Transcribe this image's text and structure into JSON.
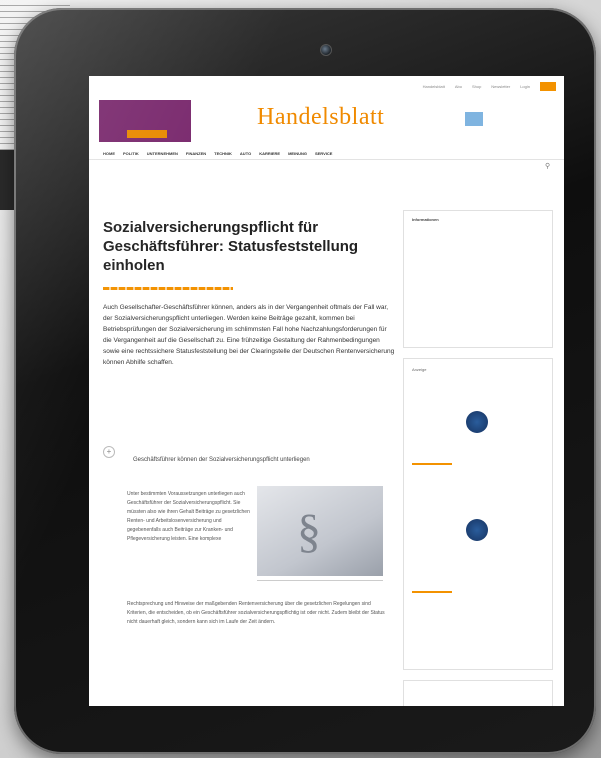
{
  "topbar": {
    "items": [
      "Handelsblatt",
      "Abo",
      "Shop",
      "Newsletter",
      "Login"
    ]
  },
  "masthead": {
    "logo": "Handelsblatt",
    "ad_line1": "",
    "ad_line2": "",
    "ad_button": "",
    "promo_text": ""
  },
  "nav": {
    "items": [
      "HOME",
      "POLITIK",
      "UNTERNEHMEN",
      "FINANZEN",
      "TECHNIK",
      "AUTO",
      "KARRIERE",
      "MEINUNG",
      "SERVICE"
    ]
  },
  "breadcrumb": "",
  "dateline": "",
  "article": {
    "title": "Sozialversicherungspflicht für Geschäftsführer: Statusfeststellung einholen",
    "meta": "",
    "lead": "Auch Gesellschafter-Geschäftsführer können, anders als in der Vergangenheit oftmals der Fall war, der Sozialversicherungspflicht unterliegen. Werden keine Beiträge gezahlt, kommen bei Betriebsprüfungen der Sozialversicherung im schlimmsten Fall hohe Nachzahlungsforderungen für die Vergangenheit auf die Gesellschaft zu. Eine frühzeitige Gestaltung der Rahmenbedingungen sowie eine rechtssichere Statusfeststellung bei der Clearingstelle der Deutschen Rentenversicherung können Abhilfe schaffen.",
    "subhead": "Geschäftsführer können der Sozialversicherungspflicht unterliegen",
    "body_col": "Unter bestimmten Voraussetzungen unterliegen auch Geschäftsführer der Sozialversicherungspflicht. Sie müssten also wie ihren Gehalt Beiträge zu gesetzlichen Renten- und Arbeitslosenversicherung und gegebenenfalls auch Beiträge zur Kranken- und Pflegeversicherung leisten. Eine komplexe",
    "body_wide": "Rechtsprechung und Hinweise der maßgebenden Rentenversicherung über die gesetzlichen Regelungen sind Kriterien, die entscheiden, ob ein Geschäftsführer sozialversicherungspflichtig ist oder nicht. Zudem bleibt der Status nicht dauerhaft gleich, sondern kann sich im Laufe der Zeit ändern."
  },
  "sidebar": {
    "info_head": "Informationen",
    "info_lines": "",
    "ad_label": "Anzeige",
    "ad1_headline": "",
    "ad2_headline": "",
    "small_label": ""
  },
  "colors": {
    "brand_orange": "#f08a00",
    "ad_purple": "#7a2a6e",
    "seal_blue": "#1c3f72"
  },
  "icons": {
    "camera": "camera-icon",
    "search": "search-icon",
    "expand": "plus-icon"
  }
}
